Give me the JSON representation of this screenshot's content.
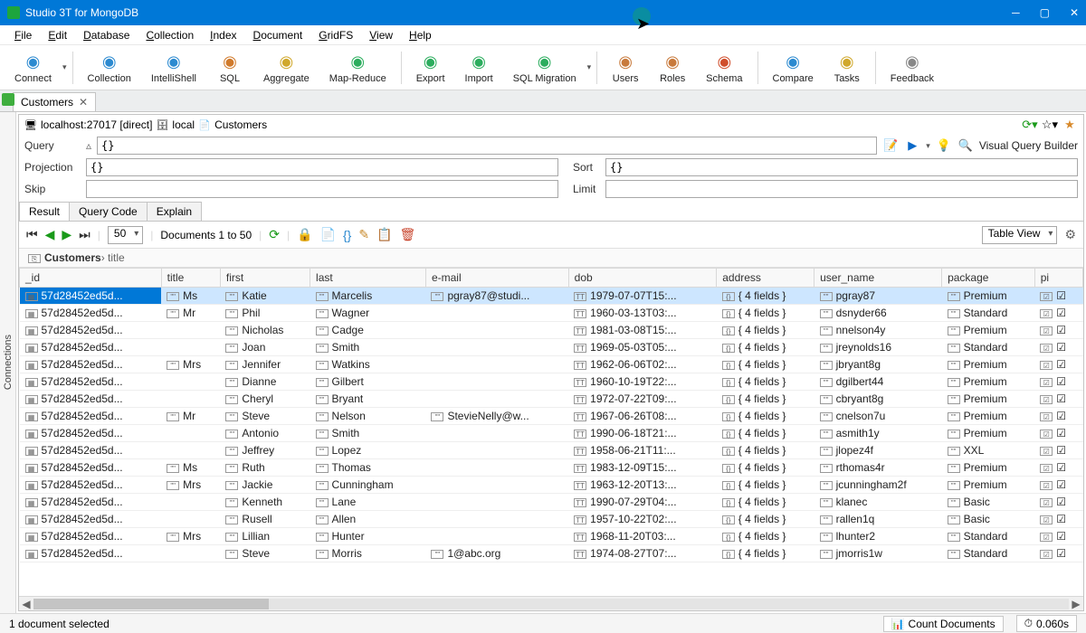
{
  "window": {
    "title": "Studio 3T for MongoDB"
  },
  "menu": [
    "File",
    "Edit",
    "Database",
    "Collection",
    "Index",
    "Document",
    "GridFS",
    "View",
    "Help"
  ],
  "toolbar": [
    {
      "label": "Connect",
      "color": "#2c8ad0"
    },
    {
      "label": "Collection",
      "color": "#2c8ad0"
    },
    {
      "label": "IntelliShell",
      "color": "#2c8ad0"
    },
    {
      "label": "SQL",
      "color": "#d07a2c"
    },
    {
      "label": "Aggregate",
      "color": "#d0a82c"
    },
    {
      "label": "Map-Reduce",
      "color": "#2cad5e"
    },
    {
      "label": "Export",
      "color": "#2cad5e"
    },
    {
      "label": "Import",
      "color": "#2cad5e"
    },
    {
      "label": "SQL Migration",
      "color": "#2cad5e"
    },
    {
      "label": "Users",
      "color": "#c87a3c"
    },
    {
      "label": "Roles",
      "color": "#c87a3c"
    },
    {
      "label": "Schema",
      "color": "#d04e2c"
    },
    {
      "label": "Compare",
      "color": "#2c8ad0"
    },
    {
      "label": "Tasks",
      "color": "#d0a82c"
    },
    {
      "label": "Feedback",
      "color": "#888"
    }
  ],
  "tab": {
    "name": "Customers"
  },
  "breadcrumb": {
    "conn": "localhost:27017 [direct]",
    "db": "local",
    "coll": "Customers"
  },
  "query": {
    "queryLabel": "Query",
    "query": "{}",
    "projectionLabel": "Projection",
    "projection": "{}",
    "sortLabel": "Sort",
    "sort": "{}",
    "skipLabel": "Skip",
    "skip": "",
    "limitLabel": "Limit",
    "limit": "",
    "visualBuilder": "Visual Query Builder"
  },
  "resultTabs": [
    "Result",
    "Query Code",
    "Explain"
  ],
  "pager": {
    "size": "50",
    "label": "Documents 1 to 50",
    "viewMode": "Table View"
  },
  "path": {
    "coll": "Customers",
    "field": "title"
  },
  "columns": [
    "_id",
    "title",
    "first",
    "last",
    "e-mail",
    "dob",
    "address",
    "user_name",
    "package",
    "pi"
  ],
  "rows": [
    {
      "id": "57d28452ed5d...",
      "title": "Ms",
      "first": "Katie",
      "last": "Marcelis",
      "email": "pgray87@studi...",
      "dob": "1979-07-07T15:...",
      "addr": "{ 4 fields }",
      "user": "pgray87",
      "pkg": "Premium",
      "sel": true
    },
    {
      "id": "57d28452ed5d...",
      "title": "Mr",
      "first": "Phil",
      "last": "Wagner",
      "email": "",
      "dob": "1960-03-13T03:...",
      "addr": "{ 4 fields }",
      "user": "dsnyder66",
      "pkg": "Standard"
    },
    {
      "id": "57d28452ed5d...",
      "title": "",
      "first": "Nicholas",
      "last": "Cadge",
      "email": "",
      "dob": "1981-03-08T15:...",
      "addr": "{ 4 fields }",
      "user": "nnelson4y",
      "pkg": "Premium"
    },
    {
      "id": "57d28452ed5d...",
      "title": "",
      "first": "Joan",
      "last": "Smith",
      "email": "",
      "dob": "1969-05-03T05:...",
      "addr": "{ 4 fields }",
      "user": "jreynolds16",
      "pkg": "Standard"
    },
    {
      "id": "57d28452ed5d...",
      "title": "Mrs",
      "first": "Jennifer",
      "last": "Watkins",
      "email": "",
      "dob": "1962-06-06T02:...",
      "addr": "{ 4 fields }",
      "user": "jbryant8g",
      "pkg": "Premium"
    },
    {
      "id": "57d28452ed5d...",
      "title": "",
      "first": "Dianne",
      "last": "Gilbert",
      "email": "",
      "dob": "1960-10-19T22:...",
      "addr": "{ 4 fields }",
      "user": "dgilbert44",
      "pkg": "Premium"
    },
    {
      "id": "57d28452ed5d...",
      "title": "",
      "first": "Cheryl",
      "last": "Bryant",
      "email": "",
      "dob": "1972-07-22T09:...",
      "addr": "{ 4 fields }",
      "user": "cbryant8g",
      "pkg": "Premium"
    },
    {
      "id": "57d28452ed5d...",
      "title": "Mr",
      "first": "Steve",
      "last": "Nelson",
      "email": "StevieNelly@w...",
      "dob": "1967-06-26T08:...",
      "addr": "{ 4 fields }",
      "user": "cnelson7u",
      "pkg": "Premium"
    },
    {
      "id": "57d28452ed5d...",
      "title": "",
      "first": "Antonio",
      "last": "Smith",
      "email": "",
      "dob": "1990-06-18T21:...",
      "addr": "{ 4 fields }",
      "user": "asmith1y",
      "pkg": "Premium"
    },
    {
      "id": "57d28452ed5d...",
      "title": "",
      "first": "Jeffrey",
      "last": "Lopez",
      "email": "",
      "dob": "1958-06-21T11:...",
      "addr": "{ 4 fields }",
      "user": "jlopez4f",
      "pkg": "XXL"
    },
    {
      "id": "57d28452ed5d...",
      "title": "Ms",
      "first": "Ruth",
      "last": "Thomas",
      "email": "",
      "dob": "1983-12-09T15:...",
      "addr": "{ 4 fields }",
      "user": "rthomas4r",
      "pkg": "Premium"
    },
    {
      "id": "57d28452ed5d...",
      "title": "Mrs",
      "first": "Jackie",
      "last": "Cunningham",
      "email": "",
      "dob": "1963-12-20T13:...",
      "addr": "{ 4 fields }",
      "user": "jcunningham2f",
      "pkg": "Premium"
    },
    {
      "id": "57d28452ed5d...",
      "title": "",
      "first": "Kenneth",
      "last": "Lane",
      "email": "",
      "dob": "1990-07-29T04:...",
      "addr": "{ 4 fields }",
      "user": "klanec",
      "pkg": "Basic"
    },
    {
      "id": "57d28452ed5d...",
      "title": "",
      "first": "Rusell",
      "last": "Allen",
      "email": "",
      "dob": "1957-10-22T02:...",
      "addr": "{ 4 fields }",
      "user": "rallen1q",
      "pkg": "Basic"
    },
    {
      "id": "57d28452ed5d...",
      "title": "Mrs",
      "first": "Lillian",
      "last": "Hunter",
      "email": "",
      "dob": "1968-11-20T03:...",
      "addr": "{ 4 fields }",
      "user": "lhunter2",
      "pkg": "Standard"
    },
    {
      "id": "57d28452ed5d...",
      "title": "",
      "first": "Steve",
      "last": "Morris",
      "email": "1@abc.org",
      "dob": "1974-08-27T07:...",
      "addr": "{ 4 fields }",
      "user": "jmorris1w",
      "pkg": "Standard"
    }
  ],
  "status": {
    "sel": "1 document selected",
    "count": "Count Documents",
    "time": "0.060s"
  },
  "sidepane": "Connections"
}
